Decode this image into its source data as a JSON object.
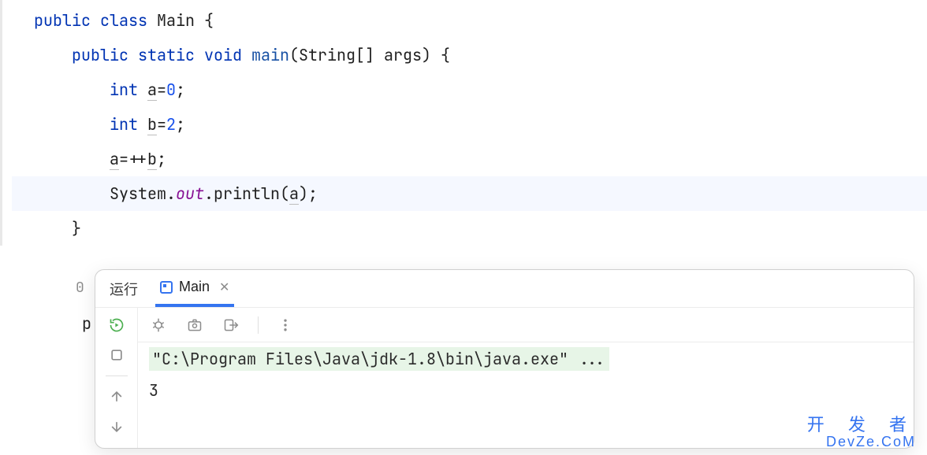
{
  "code": {
    "l1": {
      "kw1": "public",
      "kw2": "class",
      "cls": "Main",
      "brace": "{"
    },
    "l2": {
      "kw1": "public",
      "kw2": "static",
      "kw3": "void",
      "method": "main",
      "params": "(String[] args) {"
    },
    "l3": {
      "type": "int",
      "var": "a",
      "rest": "=",
      "num": "0",
      "semi": ";"
    },
    "l4": {
      "type": "int",
      "var": "b",
      "rest": "=",
      "num": "2",
      "semi": ";"
    },
    "l5": {
      "var1": "a",
      "op": "=++",
      "var2": "b",
      "semi": ";"
    },
    "l6": {
      "pre": "System.",
      "out": "out",
      "post": ".println(",
      "var": "a",
      "end": ");"
    },
    "l7": {
      "brace": "}"
    }
  },
  "gutter": {
    "zero": "0",
    "p": "p"
  },
  "panel": {
    "run_label": "运行",
    "main_tab": "Main",
    "cmd": "\"C:\\Program Files\\Java\\jdk-1.8\\bin\\java.exe\" ...",
    "output": "3"
  },
  "watermark": {
    "cn": "开 发 者",
    "en": "DevZe.CoM"
  }
}
